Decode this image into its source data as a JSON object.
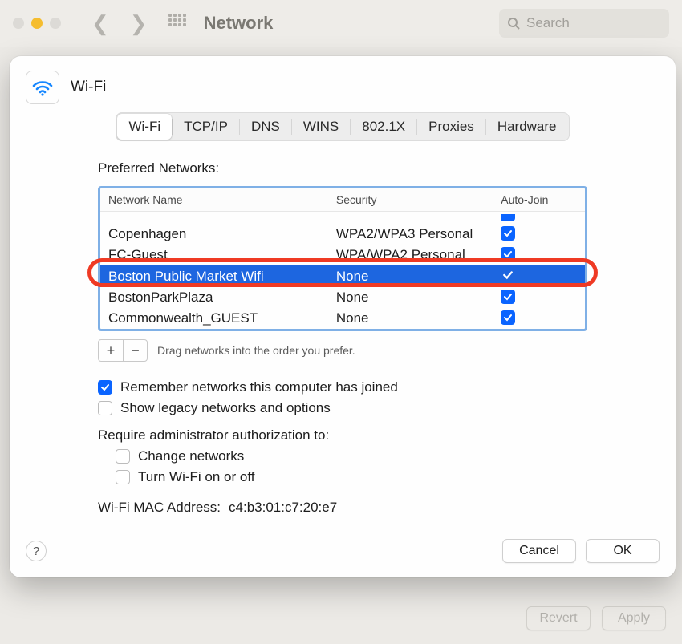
{
  "window": {
    "title": "Network",
    "search_placeholder": "Search"
  },
  "sheet": {
    "title": "Wi-Fi"
  },
  "tabs": [
    "Wi-Fi",
    "TCP/IP",
    "DNS",
    "WINS",
    "802.1X",
    "Proxies",
    "Hardware"
  ],
  "preferred_label": "Preferred Networks:",
  "columns": {
    "name": "Network Name",
    "security": "Security",
    "auto": "Auto-Join"
  },
  "networks": [
    {
      "name": "Copenhagen",
      "security": "WPA2/WPA3 Personal",
      "auto": true,
      "selected": false
    },
    {
      "name": "FC-Guest",
      "security": "WPA/WPA2 Personal",
      "auto": true,
      "selected": false
    },
    {
      "name": "Boston Public Market Wifi",
      "security": "None",
      "auto": true,
      "selected": true
    },
    {
      "name": "BostonParkPlaza",
      "security": "None",
      "auto": true,
      "selected": false
    },
    {
      "name": "Commonwealth_GUEST",
      "security": "None",
      "auto": true,
      "selected": false
    }
  ],
  "drag_hint": "Drag networks into the order you prefer.",
  "options": {
    "remember": {
      "label": "Remember networks this computer has joined",
      "checked": true
    },
    "legacy": {
      "label": "Show legacy networks and options",
      "checked": false
    },
    "require": "Require administrator authorization to:",
    "change": {
      "label": "Change networks",
      "checked": false
    },
    "toggle": {
      "label": "Turn Wi-Fi on or off",
      "checked": false
    }
  },
  "mac": {
    "label": "Wi-Fi MAC Address:",
    "value": "c4:b3:01:c7:20:e7"
  },
  "buttons": {
    "cancel": "Cancel",
    "ok": "OK",
    "help": "?"
  },
  "behind": {
    "revert": "Revert",
    "apply": "Apply"
  },
  "icons": {
    "plus": "+",
    "minus": "−"
  }
}
